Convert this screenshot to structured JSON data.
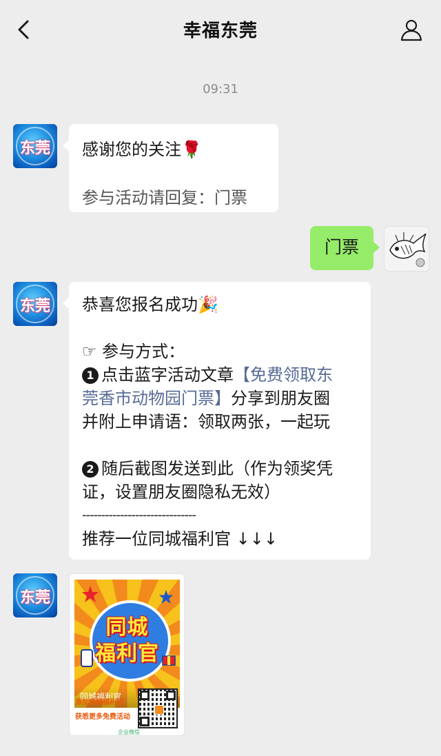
{
  "header": {
    "title": "幸福东莞"
  },
  "timestamp": "09:31",
  "avatar_text": "东莞",
  "messages": {
    "welcome": {
      "line1": "感谢您的关注",
      "line1_emoji": "🌹",
      "line2": "参与活动请回复：门票"
    },
    "user_reply": "门票",
    "success": {
      "line1": "恭喜您报名成功",
      "line1_emoji": "🎉",
      "method_hand": "☞",
      "method_title": "参与方式：",
      "step1_num": "1",
      "step1_prefix": "点击蓝字活动文章",
      "step1_link_a": "【免费领取东",
      "step1_link_b": "莞香市动物园门票】",
      "step1_suffix": "分享到朋友圈",
      "step1_line3": "并附上申请语：领取两张，一起玩",
      "step2_num": "2",
      "step2_line1": "随后截图发送到此（作为领奖凭",
      "step2_line2": "证，设置朋友圈隐私无效）",
      "divider": "------------------------------",
      "recommend": "推荐一位同城福利官 ↓↓↓"
    },
    "image_card": {
      "poster_title_1": "同城",
      "poster_title_2": "福利官",
      "poster_caption": "同城福利官",
      "line1": "添加同城福利官",
      "line2": "获悉更多免费活动",
      "brand": "企业微信"
    }
  }
}
